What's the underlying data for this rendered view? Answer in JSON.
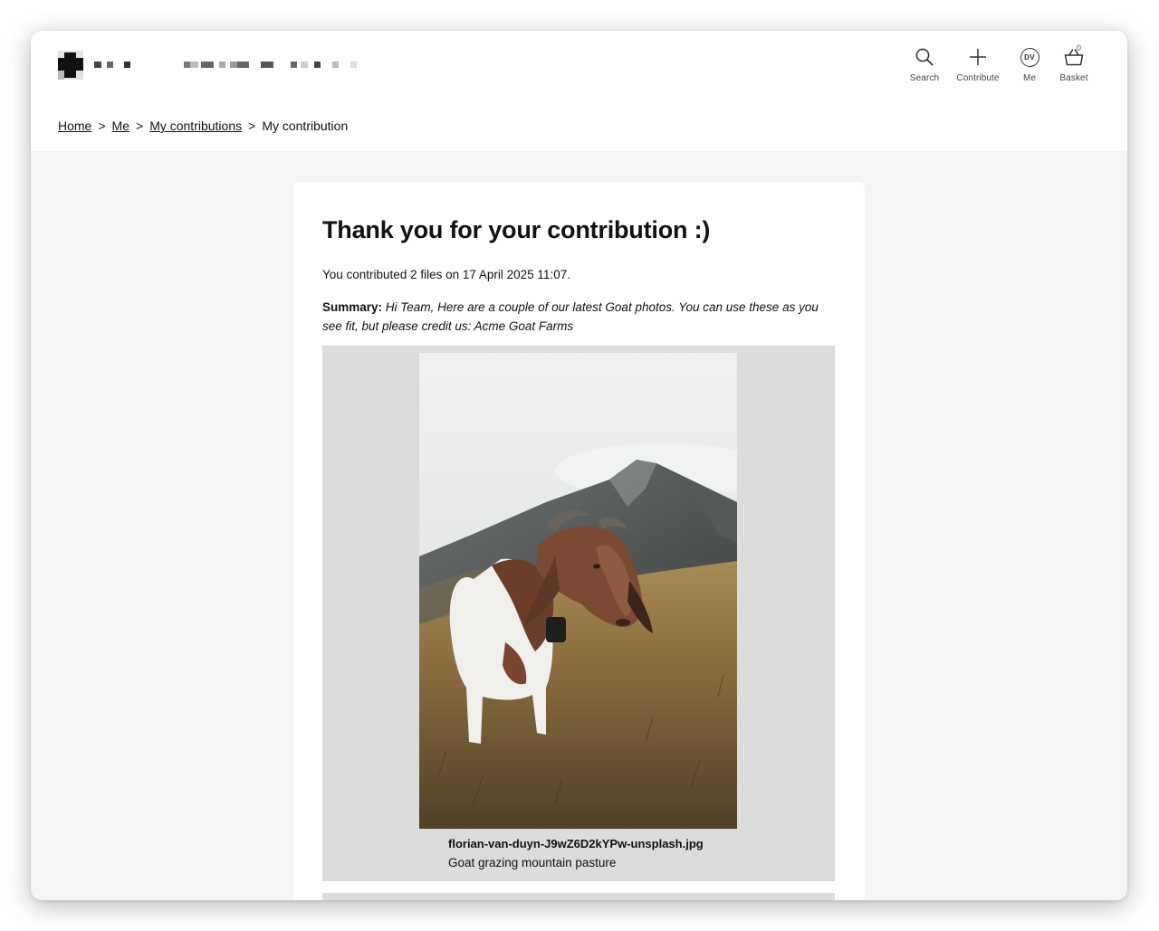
{
  "nav": {
    "search_label": "Search",
    "contribute_label": "Contribute",
    "me_label": "Me",
    "me_initials": "DV",
    "basket_label": "Basket",
    "basket_count": "0"
  },
  "breadcrumb": {
    "home": "Home",
    "me": "Me",
    "my_contributions": "My contributions",
    "current": "My contribution",
    "separator": ">"
  },
  "contribution": {
    "heading": "Thank you for your contribution :)",
    "contributed_line": "You contributed 2 files on 17 April 2025 11:07.",
    "summary_label": "Summary:",
    "summary_text": "Hi Team, Here are a couple of our latest Goat photos. You can use these as you see fit, but please credit us: Acme Goat Farms",
    "files": [
      {
        "filename": "florian-van-duyn-J9wZ6D2kYPw-unsplash.jpg",
        "description": "Goat grazing mountain pasture"
      }
    ]
  },
  "colors": {
    "page_bg": "#f5f5f5",
    "card_bg": "#ffffff",
    "panel_bg": "#dcdcdc",
    "text": "#111111"
  },
  "icons": [
    "search-icon",
    "plus-icon",
    "avatar-icon",
    "basket-icon",
    "logo"
  ]
}
